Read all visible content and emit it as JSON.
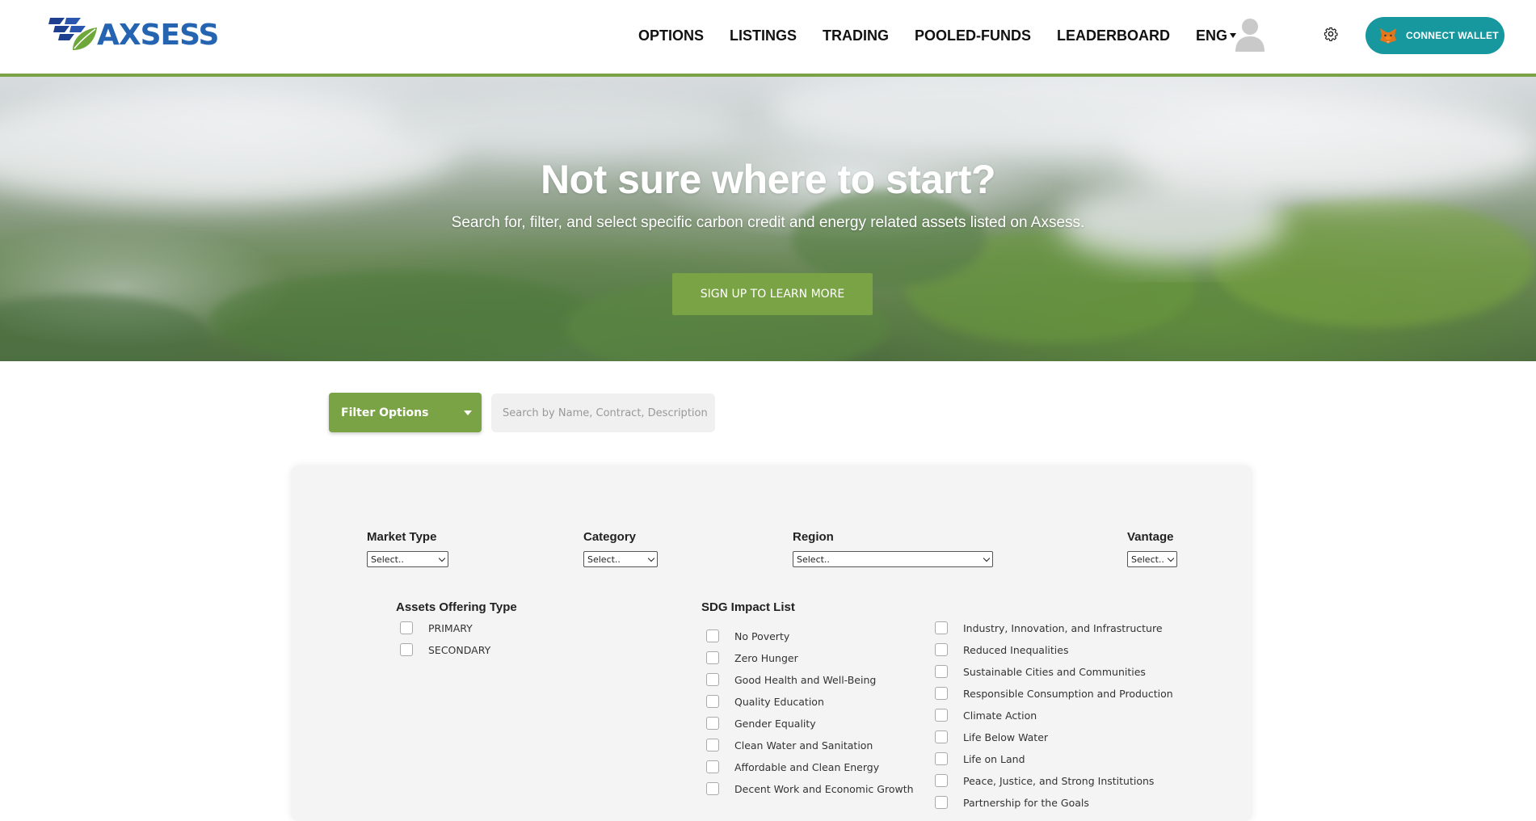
{
  "header": {
    "logo_text": "AXSESS",
    "nav": [
      "OPTIONS",
      "LISTINGS",
      "TRADING",
      "POOLED-FUNDS",
      "LEADERBOARD"
    ],
    "language": "ENG",
    "connect_wallet": "CONNECT WALLET",
    "brand_color": "#2464b0",
    "accent_color": "#7aa346",
    "wallet_color": "#17979e"
  },
  "hero": {
    "title": "Not sure where to start?",
    "subtitle": "Search for, filter, and select specific carbon credit and energy related assets listed on Axsess.",
    "cta": "SIGN UP TO LEARN MORE"
  },
  "filter": {
    "button_label": "Filter Options",
    "search_placeholder": "Search by Name, Contract, Description"
  },
  "panel": {
    "market_type": {
      "label": "Market Type",
      "value": "Select.."
    },
    "category": {
      "label": "Category",
      "value": "Select.."
    },
    "region": {
      "label": "Region",
      "value": "Select.."
    },
    "vantage": {
      "label": "Vantage",
      "value": "Select.."
    },
    "assets_offering": {
      "label": "Assets Offering Type",
      "options": [
        "PRIMARY",
        "SECONDARY"
      ]
    },
    "sdg": {
      "label": "SDG Impact List",
      "col1": [
        "No Poverty",
        "Zero Hunger",
        "Good Health and Well-Being",
        "Quality Education",
        "Gender Equality",
        "Clean Water and Sanitation",
        "Affordable and Clean Energy",
        "Decent Work and Economic Growth"
      ],
      "col2": [
        "Industry, Innovation, and Infrastructure",
        "Reduced Inequalities",
        "Sustainable Cities and Communities",
        "Responsible Consumption and Production",
        "Climate Action",
        "Life Below Water",
        "Life on Land",
        "Peace, Justice, and Strong Institutions",
        "Partnership for the Goals"
      ]
    }
  }
}
